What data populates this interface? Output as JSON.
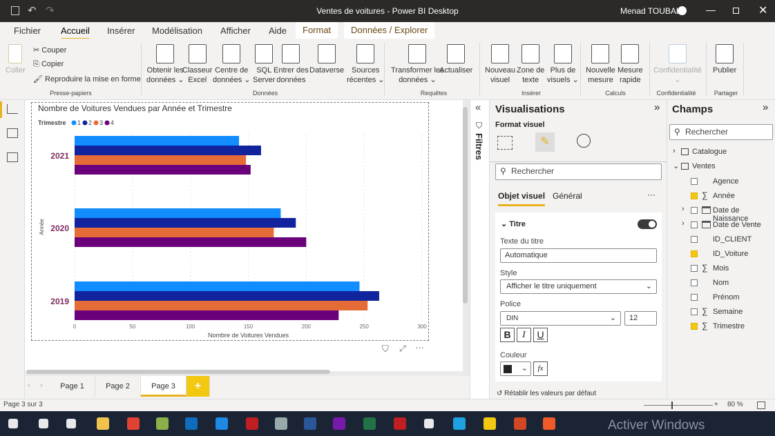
{
  "window": {
    "title": "Ventes de voitures - Power BI Desktop",
    "user": "Menad TOUBAL"
  },
  "menu": {
    "tabs": [
      "Fichier",
      "Accueil",
      "Insérer",
      "Modélisation",
      "Afficher",
      "Aide",
      "Format",
      "Données / Explorer"
    ],
    "active": "Accueil"
  },
  "ribbon": {
    "clipboard": {
      "paste": "Coller",
      "cut": "Couper",
      "copy": "Copier",
      "format_painter": "Reproduire la mise en forme",
      "group": "Presse-papiers"
    },
    "data": {
      "buttons": [
        [
          "Obtenir les",
          "données ⌄"
        ],
        [
          "Classeur",
          "Excel"
        ],
        [
          "Centre de",
          "données ⌄"
        ],
        [
          "SQL",
          "Server"
        ],
        [
          "Entrer des",
          "données"
        ],
        [
          "Dataverse",
          ""
        ],
        [
          "Sources",
          "récentes ⌄"
        ]
      ],
      "group": "Données"
    },
    "queries": {
      "buttons": [
        [
          "Transformer les",
          "données ⌄"
        ],
        [
          "Actualiser",
          ""
        ]
      ],
      "group": "Requêtes"
    },
    "insert": {
      "buttons": [
        [
          "Nouveau",
          "visuel"
        ],
        [
          "Zone de",
          "texte"
        ],
        [
          "Plus de",
          "visuels ⌄"
        ]
      ],
      "group": "Insérer"
    },
    "calc": {
      "buttons": [
        [
          "Nouvelle",
          "mesure"
        ],
        [
          "Mesure",
          "rapide"
        ]
      ],
      "group": "Calculs"
    },
    "sensitivity": {
      "buttons": [
        [
          "Confidentialité",
          "⌄"
        ]
      ],
      "group": "Confidentialité"
    },
    "share": {
      "buttons": [
        [
          "Publier",
          ""
        ]
      ],
      "group": "Partager"
    }
  },
  "chart_data": {
    "type": "bar",
    "orientation": "horizontal",
    "title": "Nombre de Voitures Vendues par Année et Trimestre",
    "legend_title": "Trimestre",
    "legend_position": "top-left",
    "categories": [
      "2021",
      "2020",
      "2019"
    ],
    "series": [
      {
        "name": "1",
        "color": "#118DFF",
        "values": [
          142,
          178,
          246
        ]
      },
      {
        "name": "2",
        "color": "#12239E",
        "values": [
          161,
          191,
          263
        ]
      },
      {
        "name": "3",
        "color": "#E66C37",
        "values": [
          148,
          172,
          253
        ]
      },
      {
        "name": "4",
        "color": "#6B007B",
        "values": [
          152,
          200,
          228
        ]
      }
    ],
    "xlabel": "Nombre de Voitures Vendues",
    "ylabel": "Année",
    "xlim": [
      0,
      300
    ],
    "xticks": [
      "0",
      "50",
      "100",
      "150",
      "200",
      "250",
      "300"
    ],
    "grid": true
  },
  "pages": {
    "tabs": [
      "Page 1",
      "Page 2",
      "Page 3"
    ],
    "active": "Page 3",
    "add": "+"
  },
  "filters": {
    "label": "Filtres"
  },
  "viz": {
    "title": "Visualisations",
    "subtitle": "Format visuel",
    "search_placeholder": "Rechercher",
    "tabs": [
      "Objet visuel",
      "Général"
    ],
    "more": "···",
    "section": "Titre",
    "title_text_label": "Texte du titre",
    "title_text_value": "Automatique",
    "style_label": "Style",
    "style_value": "Afficher le titre uniquement",
    "font_label": "Police",
    "font_value": "DIN",
    "font_size": "12",
    "bold": "B",
    "italic": "I",
    "underline": "U",
    "color_label": "Couleur",
    "color_value": "#252423",
    "fx": "fx",
    "reset": "Rétablir les valeurs par défaut"
  },
  "fields": {
    "title": "Champs",
    "search_placeholder": "Rechercher",
    "tables": [
      {
        "name": "Catalogue",
        "expanded": false
      },
      {
        "name": "Ventes",
        "expanded": true
      }
    ],
    "items": [
      {
        "name": "Agence",
        "checked": false,
        "icon": ""
      },
      {
        "name": "Année",
        "checked": true,
        "icon": "sigma"
      },
      {
        "name": "Date de Naissance",
        "checked": false,
        "icon": "calendar"
      },
      {
        "name": "Date de Vente",
        "checked": false,
        "icon": "calendar"
      },
      {
        "name": "ID_CLIENT",
        "checked": false,
        "icon": ""
      },
      {
        "name": "ID_Voiture",
        "checked": true,
        "icon": ""
      },
      {
        "name": "Mois",
        "checked": false,
        "icon": "sigma"
      },
      {
        "name": "Nom",
        "checked": false,
        "icon": ""
      },
      {
        "name": "Prénom",
        "checked": false,
        "icon": ""
      },
      {
        "name": "Semaine",
        "checked": false,
        "icon": "sigma"
      },
      {
        "name": "Trimestre",
        "checked": true,
        "icon": "sigma"
      }
    ]
  },
  "status": {
    "page": "Page 3 sur 3",
    "zoom": "80 %"
  },
  "taskbar": {
    "watermark": "Activer Windows"
  }
}
